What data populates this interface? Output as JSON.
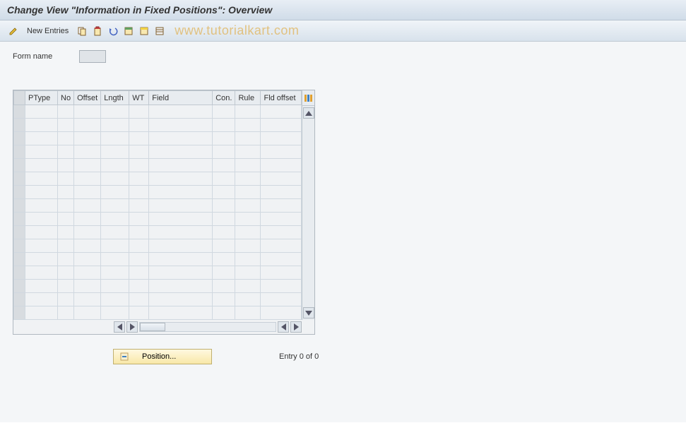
{
  "title": "Change View \"Information in Fixed Positions\": Overview",
  "toolbar": {
    "new_entries_label": "New Entries"
  },
  "watermark": "www.tutorialkart.com",
  "form": {
    "form_name_label": "Form name",
    "form_name_value": ""
  },
  "table": {
    "columns": [
      "PType",
      "No",
      "Offset",
      "Lngth",
      "WT",
      "Field",
      "Con.",
      "Rule",
      "Fld offset"
    ],
    "row_count": 16
  },
  "footer": {
    "position_label": "Position...",
    "entry_text": "Entry 0 of 0"
  }
}
